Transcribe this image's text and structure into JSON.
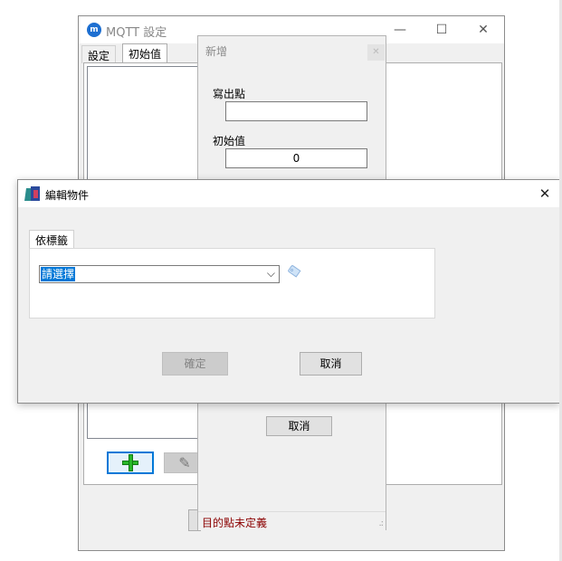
{
  "mqtt_window": {
    "title": "MQTT 設定",
    "icon": "mqtt-cloud-icon",
    "controls": {
      "minimize": "—",
      "maximize": "☐",
      "close": "✕"
    },
    "tabs": [
      {
        "label": "設定",
        "active": false
      },
      {
        "label": "初始值",
        "active": true
      }
    ],
    "add_icon": "plus-icon",
    "edit_icon": "pencil-icon"
  },
  "add_dialog": {
    "title": "新增",
    "write_point_label": "寫出點",
    "write_point_value": "",
    "initial_value_label": "初始值",
    "initial_value": "0",
    "cancel_label": "取消",
    "status_text": "目的點未定義",
    "status_color": "#8b0000"
  },
  "edit_dialog": {
    "title": "編輯物件",
    "close_glyph": "✕",
    "tab_label": "依標籤",
    "tag_select_value": "請選擇",
    "tag_select_chevron": "⌵",
    "tag_icon": "tag-icon",
    "ok_label": "確定",
    "ok_enabled": false,
    "cancel_label": "取消"
  },
  "colors": {
    "accent": "#0078d7",
    "dialog_bg": "#f0f0f0",
    "disabled_button": "#cccccc"
  }
}
